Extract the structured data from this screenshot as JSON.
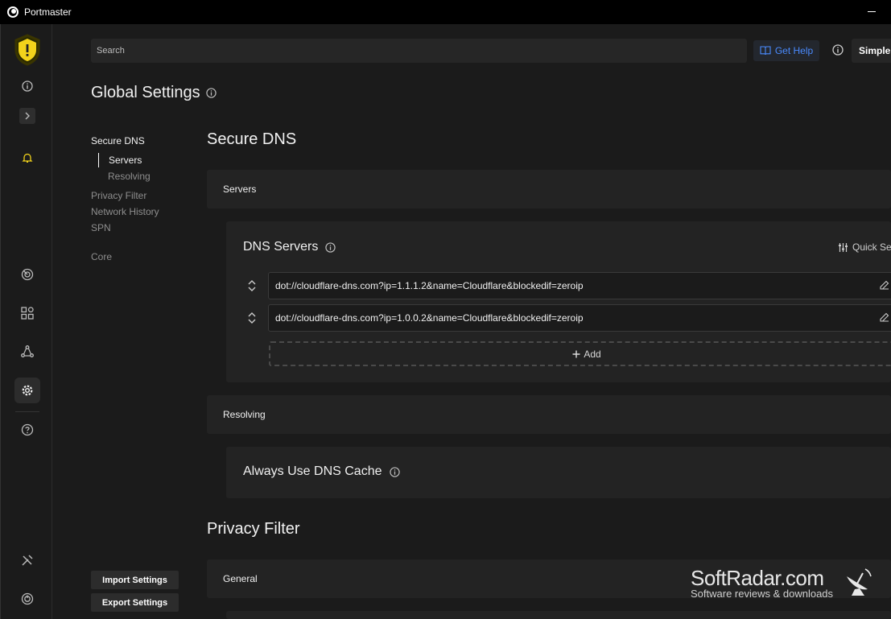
{
  "window": {
    "title": "Portmaster"
  },
  "search": {
    "placeholder": "Search"
  },
  "header": {
    "get_help": "Get Help",
    "mode": "Simple I"
  },
  "page": {
    "title": "Global Settings"
  },
  "subnav": {
    "secure_dns": "Secure DNS",
    "servers": "Servers",
    "resolving": "Resolving",
    "privacy_filter": "Privacy Filter",
    "network_history": "Network History",
    "spn": "SPN",
    "core": "Core"
  },
  "actions": {
    "import": "Import Settings",
    "export": "Export Settings"
  },
  "content": {
    "secure_dns_heading": "Secure DNS",
    "servers_label": "Servers",
    "dns_servers": {
      "title": "DNS Servers",
      "quick_settings": "Quick Se",
      "entries": [
        "dot://cloudflare-dns.com?ip=1.1.1.2&name=Cloudflare&blockedif=zeroip",
        "dot://cloudflare-dns.com?ip=1.0.0.2&name=Cloudflare&blockedif=zeroip"
      ],
      "add_label": "Add"
    },
    "resolving_label": "Resolving",
    "dns_cache_title": "Always Use DNS Cache",
    "privacy_filter_heading": "Privacy Filter",
    "general_label": "General"
  },
  "watermark": {
    "main": "SoftRadar.com",
    "sub": "Software reviews & downloads"
  },
  "colors": {
    "accent": "#4a8bff",
    "warning": "#f2d31b",
    "background": "#1b1b1b",
    "panel": "#232323"
  },
  "icons": [
    "shield-warning-icon",
    "info-icon",
    "chevron-right-icon",
    "bell-icon",
    "radar-icon",
    "apps-icon",
    "network-icon",
    "gear-icon",
    "help-icon",
    "tools-icon",
    "power-icon",
    "book-icon",
    "sliders-icon",
    "edit-icon",
    "plus-icon",
    "reorder-icon"
  ]
}
